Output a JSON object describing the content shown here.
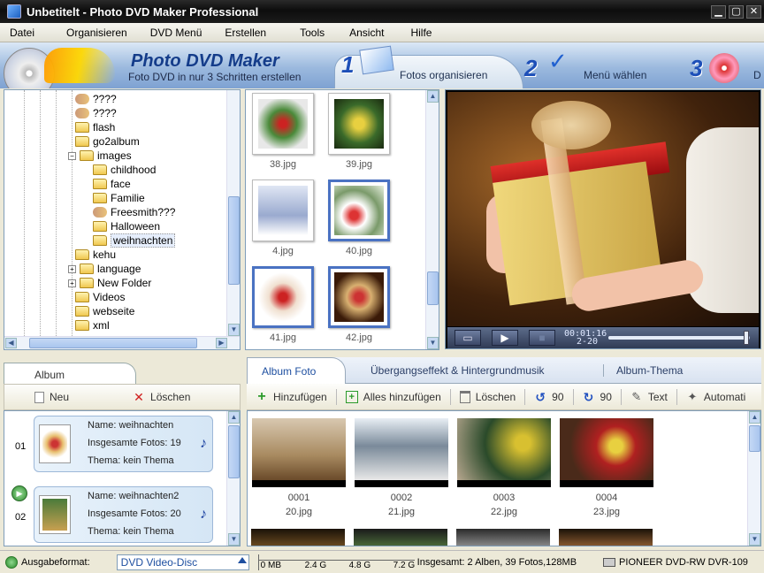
{
  "window": {
    "title": "Unbetitelt - Photo DVD Maker Professional",
    "minimize_glyph": "▁",
    "maximize_glyph": "▢",
    "close_glyph": "✕"
  },
  "menu": [
    "Datei",
    "Organisieren",
    "DVD Menü",
    "Erstellen",
    "Tools",
    "Ansicht",
    "Hilfe"
  ],
  "header": {
    "brand": "Photo DVD Maker",
    "tagline": "Foto DVD in nur 3 Schritten erstellen",
    "steps": [
      {
        "num": "1",
        "label": "Fotos organisieren"
      },
      {
        "num": "2",
        "label": "Menü wählen"
      },
      {
        "num": "3",
        "label": "D"
      }
    ]
  },
  "tree": {
    "items": [
      {
        "label": "????",
        "icon": "broken-folder-icon"
      },
      {
        "label": "????",
        "icon": "broken-folder-icon"
      },
      {
        "label": "flash",
        "icon": "folder-icon"
      },
      {
        "label": "go2album",
        "icon": "folder-icon"
      },
      {
        "label": "images",
        "icon": "folder-icon",
        "expander": "−"
      },
      {
        "label": "childhood",
        "icon": "folder-icon"
      },
      {
        "label": "face",
        "icon": "folder-icon"
      },
      {
        "label": "Familie",
        "icon": "folder-icon"
      },
      {
        "label": "Freesmith???",
        "icon": "broken-folder-icon"
      },
      {
        "label": "Halloween",
        "icon": "folder-icon"
      },
      {
        "label": "weihnachten",
        "icon": "folder-icon",
        "selected": true
      },
      {
        "label": "kehu",
        "icon": "folder-icon"
      },
      {
        "label": "language",
        "icon": "folder-icon",
        "expander": "+"
      },
      {
        "label": "New Folder",
        "icon": "folder-icon",
        "expander": "+"
      },
      {
        "label": "Videos",
        "icon": "folder-icon"
      },
      {
        "label": "webseite",
        "icon": "folder-icon"
      },
      {
        "label": "xml",
        "icon": "folder-icon"
      }
    ]
  },
  "thumbnails": [
    {
      "file": "38.jpg",
      "selected": false
    },
    {
      "file": "39.jpg",
      "selected": false
    },
    {
      "file": "4.jpg",
      "selected": false
    },
    {
      "file": "40.jpg",
      "selected": true
    },
    {
      "file": "41.jpg",
      "selected": true
    },
    {
      "file": "42.jpg",
      "selected": true
    }
  ],
  "player": {
    "time_current": "00:01:16",
    "time_total": "2-20",
    "play_glyph": "▶",
    "stop_glyph": "■",
    "frame_glyph": "▭",
    "seek_position": 0.98
  },
  "album_panel": {
    "tab": "Album",
    "new_label": "Neu",
    "delete_label": "Löschen",
    "albums": [
      {
        "index": "01",
        "name": "Name: weihnachten",
        "count": "Insgesamte Fotos: 19",
        "theme": "Thema: kein Thema"
      },
      {
        "index": "02",
        "name": "Name: weihnachten2",
        "count": "Insgesamte Fotos: 20",
        "theme": "Thema: kein Thema"
      }
    ]
  },
  "right_tabs": [
    "Album Foto",
    "Übergangseffekt & Hintergrundmusik",
    "Album-Thema"
  ],
  "toolbar": {
    "add": "Hinzufügen",
    "add_all": "Alles hinzufügen",
    "delete": "Löschen",
    "rotate_left": "90",
    "rotate_right": "90",
    "text": "Text",
    "auto": "Automati"
  },
  "photos": [
    {
      "num": "0001",
      "file": "20.jpg"
    },
    {
      "num": "0002",
      "file": "21.jpg"
    },
    {
      "num": "0003",
      "file": "22.jpg"
    },
    {
      "num": "0004",
      "file": "23.jpg"
    }
  ],
  "status": {
    "format_label": "Ausgabeformat:",
    "format_value": "DVD Video-Disc",
    "meter_labels": [
      "0 MB",
      "2.4 G",
      "4.8 G",
      "7.2 G"
    ],
    "summary": "Insgesamt: 2 Alben, 39 Fotos,128MB",
    "drive": "PIONEER  DVD-RW  DVR-109"
  },
  "colors": {
    "accent": "#1d4fb8",
    "selection": "#4a72c2",
    "add_green": "#2a9a2a",
    "delete_red": "#d02020"
  }
}
